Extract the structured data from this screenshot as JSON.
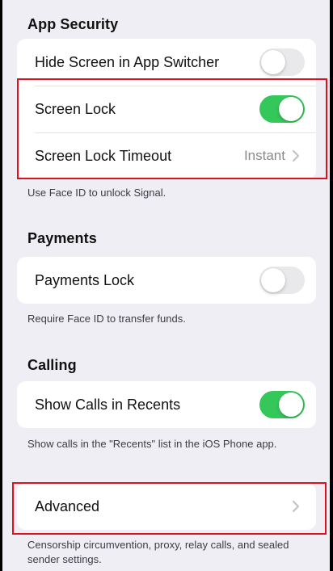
{
  "app_security": {
    "header": "App Security",
    "rows": [
      {
        "label": "Hide Screen in App Switcher",
        "toggle": "off"
      },
      {
        "label": "Screen Lock",
        "toggle": "on"
      },
      {
        "label": "Screen Lock Timeout",
        "value": "Instant"
      }
    ],
    "footer": "Use Face ID to unlock Signal."
  },
  "payments": {
    "header": "Payments",
    "rows": [
      {
        "label": "Payments Lock",
        "toggle": "off"
      }
    ],
    "footer": "Require Face ID to transfer funds."
  },
  "calling": {
    "header": "Calling",
    "rows": [
      {
        "label": "Show Calls in Recents",
        "toggle": "on"
      }
    ],
    "footer": "Show calls in the \"Recents\" list in the iOS Phone app."
  },
  "advanced": {
    "label": "Advanced",
    "footer": "Censorship circumvention, proxy, relay calls, and sealed sender settings."
  },
  "colors": {
    "toggle_on": "#34c759",
    "toggle_off": "#e9e9eb",
    "highlight": "#e0101e",
    "background": "#efeef4"
  },
  "icons": [
    "chevron-right-icon"
  ]
}
